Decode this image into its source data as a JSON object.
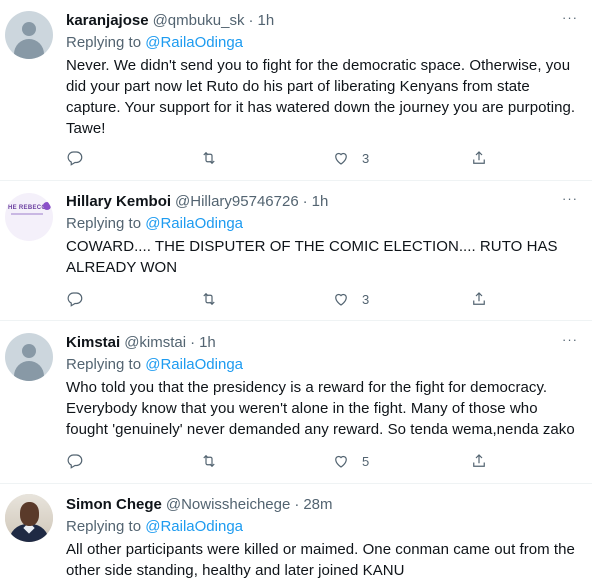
{
  "tweets": [
    {
      "name": "karanjajose",
      "handle": "@qmbuku_sk",
      "sep": "·",
      "time": "1h",
      "replying_prefix": "Replying to ",
      "replying_to": "@RailaOdinga",
      "text": "Never. We didn't send you to fight for the democratic space. Otherwise, you did your part now let Ruto do his part of liberating Kenyans from state capture. Your support for it has watered down the journey you are purpoting. Tawe!",
      "likes": "3",
      "avatar": "default-avatar"
    },
    {
      "name": "Hillary Kemboi",
      "handle": "@Hillary95746726",
      "sep": "·",
      "time": "1h",
      "replying_prefix": "Replying to ",
      "replying_to": "@RailaOdinga",
      "text": "COWARD.... THE DISPUTER OF THE COMIC ELECTION.... RUTO HAS ALREADY WON",
      "likes": "3",
      "avatar": "logo-avatar",
      "avatar_text": "HE REBECCA"
    },
    {
      "name": "Kimstai",
      "handle": "@kimstai",
      "sep": "·",
      "time": "1h",
      "replying_prefix": "Replying to ",
      "replying_to": "@RailaOdinga",
      "text": "Who told you that the presidency is a reward for the fight for democracy. Everybody know that you weren't alone in the fight. Many of those who fought 'genuinely' never demanded any reward. So tenda wema,nenda zako",
      "likes": "5",
      "avatar": "default-avatar"
    },
    {
      "name": "Simon Chege",
      "handle": "@Nowissheichege",
      "sep": "·",
      "time": "28m",
      "replying_prefix": "Replying to ",
      "replying_to": "@RailaOdinga",
      "text": "All other participants were killed or maimed. One conman came out from the other side standing, healthy and later joined KANU",
      "avatar": "photo-avatar"
    }
  ],
  "icons": {
    "more": "more-icon",
    "reply": "reply-icon",
    "retweet": "retweet-icon",
    "like": "like-icon",
    "share": "share-icon"
  },
  "colors": {
    "link": "#1d9bf0",
    "secondary_text": "#536471",
    "primary_text": "#0f1419",
    "divider": "#eff3f4"
  }
}
